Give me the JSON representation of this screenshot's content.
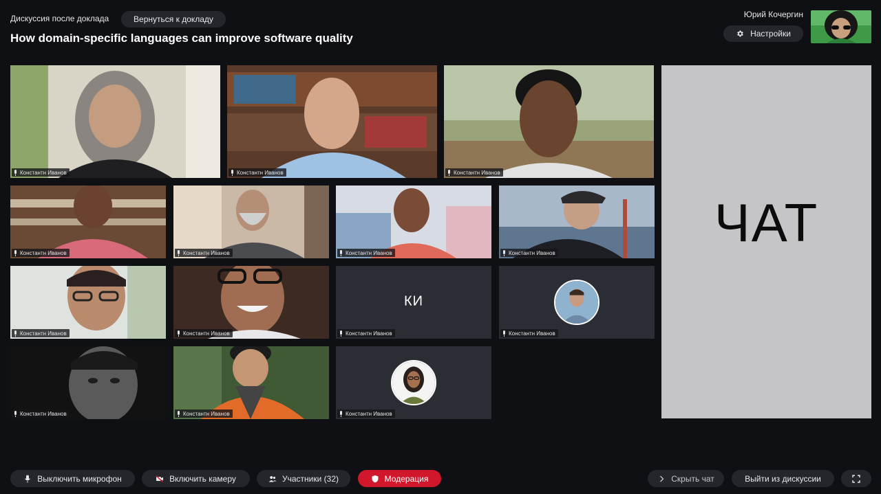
{
  "header": {
    "section_label": "Дискуссия после доклада",
    "back_button": "Вернуться к докладу",
    "title": "How domain-specific languages can improve software quality",
    "user_name": "Юрий Кочергин",
    "settings_button": "Настройки"
  },
  "participants": [
    {
      "name": "Константн Иванов",
      "kind": "video"
    },
    {
      "name": "Константн Иванов",
      "kind": "video"
    },
    {
      "name": "Константн Иванов",
      "kind": "video"
    },
    {
      "name": "Константн Иванов",
      "kind": "video"
    },
    {
      "name": "Константн Иванов",
      "kind": "video"
    },
    {
      "name": "Константн Иванов",
      "kind": "video"
    },
    {
      "name": "Константн Иванов",
      "kind": "video"
    },
    {
      "name": "Константн Иванов",
      "kind": "video"
    },
    {
      "name": "Константн Иванов",
      "kind": "video"
    },
    {
      "name": "Константн Иванов",
      "kind": "initials",
      "initials": "КИ"
    },
    {
      "name": "Константн Иванов",
      "kind": "avatar"
    },
    {
      "name": "Константн Иванов",
      "kind": "video"
    },
    {
      "name": "Константн Иванов",
      "kind": "video"
    },
    {
      "name": "Константн Иванов",
      "kind": "avatar"
    }
  ],
  "chat": {
    "title": "ЧАТ"
  },
  "toolbar": {
    "mic_button": "Выключить микрофон",
    "camera_button": "Включить камеру",
    "participants_button": "Участники (32)",
    "moderation_button": "Модерация",
    "hide_chat_button": "Скрыть чат",
    "leave_button": "Выйти из дискуссии"
  },
  "colors": {
    "background": "#0f1013",
    "pill": "#24262b",
    "accent_red": "#d0172c",
    "chat_panel": "#c5c5c7",
    "empty_tile": "#2a2d33"
  },
  "icons": [
    "gear-icon",
    "mic-icon",
    "camera-off-icon",
    "users-icon",
    "shield-icon",
    "chevron-right-icon",
    "fullscreen-icon"
  ]
}
